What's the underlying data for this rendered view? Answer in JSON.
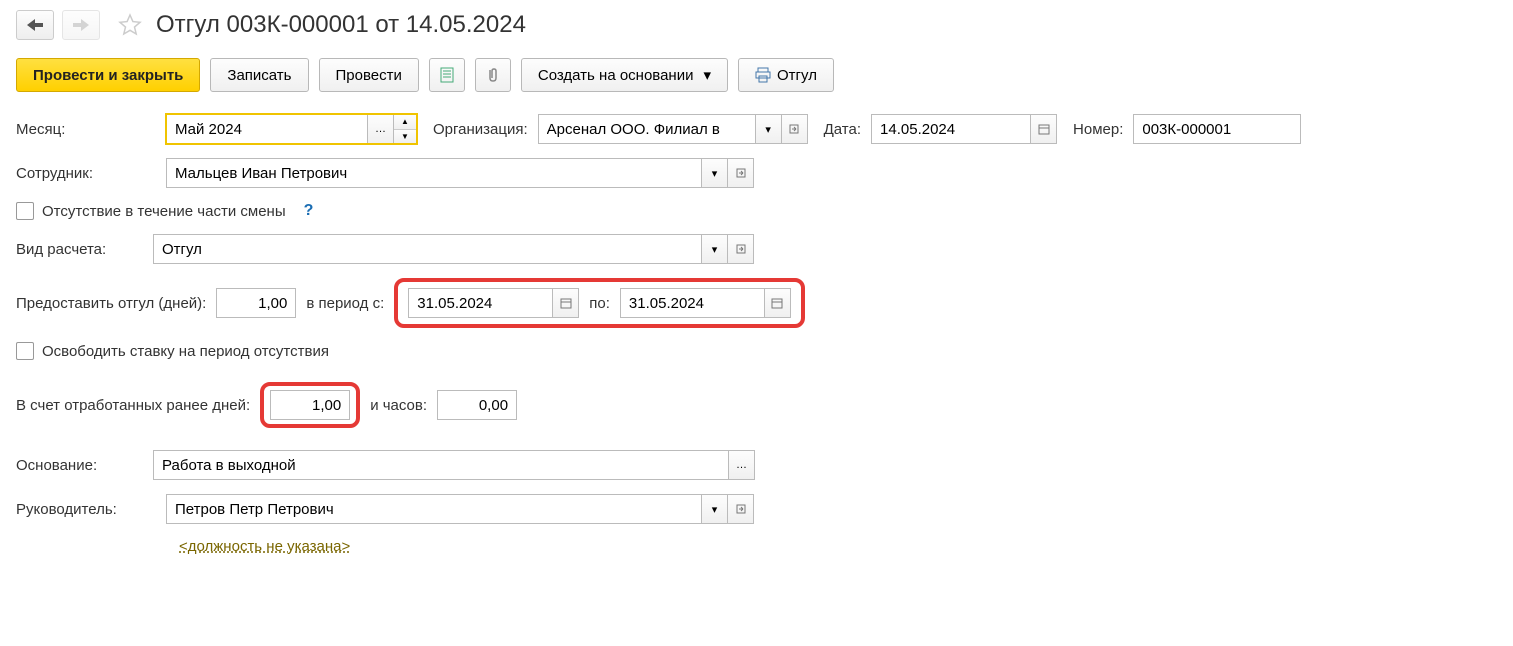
{
  "title": "Отгул 003К-000001 от 14.05.2024",
  "toolbar": {
    "post_close": "Провести и закрыть",
    "save": "Записать",
    "post": "Провести",
    "create_based": "Создать на основании",
    "print_label": "Отгул"
  },
  "labels": {
    "month": "Месяц:",
    "organization": "Организация:",
    "date": "Дата:",
    "number": "Номер:",
    "employee": "Сотрудник:",
    "partial_shift": "Отсутствие в течение части смены",
    "calc_type": "Вид расчета:",
    "days_off": "Предоставить отгул (дней):",
    "period_from": "в период с:",
    "period_to": "по:",
    "free_rate": "Освободить ставку на период отсутствия",
    "prev_days": "В счет отработанных ранее дней:",
    "and_hours": "и часов:",
    "basis": "Основание:",
    "manager": "Руководитель:",
    "position_missing": "<должность не указана>"
  },
  "values": {
    "month": "Май 2024",
    "organization": "Арсенал ООО. Филиал в",
    "date": "14.05.2024",
    "number": "003К-000001",
    "employee": "Мальцев Иван Петрович",
    "calc_type": "Отгул",
    "days_off": "1,00",
    "period_from": "31.05.2024",
    "period_to": "31.05.2024",
    "prev_days": "1,00",
    "prev_hours": "0,00",
    "basis": "Работа в выходной",
    "manager": "Петров Петр Петрович"
  }
}
